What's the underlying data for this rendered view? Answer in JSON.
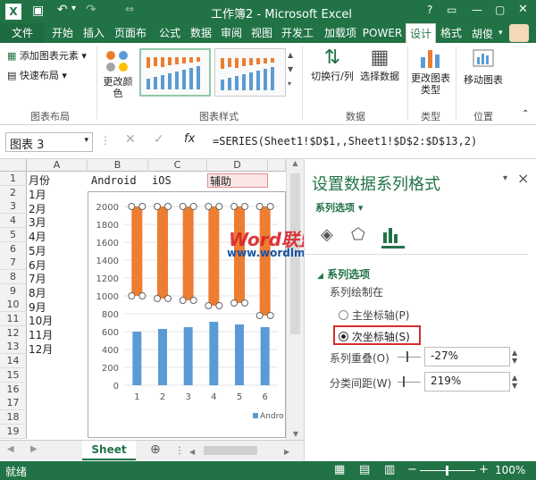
{
  "window": {
    "title": "工作簿2 - Microsoft Excel",
    "help": "?"
  },
  "colors": {
    "excel_green": "#217346",
    "orange": "#ed7d31",
    "blue": "#5b9bd5",
    "highlight_red": "#d32f2f"
  },
  "ribbon_tabs": [
    "文件",
    "开始",
    "插入",
    "页面布",
    "公式",
    "数据",
    "审阅",
    "视图",
    "开发工",
    "加载项",
    "POWER",
    "设计",
    "格式"
  ],
  "user": "胡俊",
  "ribbon": {
    "add_element": "添加图表元素",
    "quick_layout": "快速布局",
    "change_colors": "更改颜色",
    "switch_row_col": "切换行/列",
    "select_data": "选择数据",
    "change_type": "更改图表类型",
    "move_chart": "移动图表",
    "groups": {
      "layout": "图表布局",
      "styles": "图表样式",
      "data": "数据",
      "type": "类型",
      "location": "位置"
    }
  },
  "formula_bar": {
    "name_box": "图表 3",
    "fx": "fx",
    "formula": "=SERIES(Sheet1!$D$1,,Sheet1!$D$2:$D$13,2)"
  },
  "columns": [
    "A",
    "B",
    "C",
    "D"
  ],
  "rows": [
    "1",
    "2",
    "3",
    "4",
    "5",
    "6",
    "7",
    "8",
    "9",
    "10",
    "11",
    "12",
    "13",
    "14",
    "15",
    "16",
    "17",
    "18",
    "19"
  ],
  "cells": {
    "A1": "月份",
    "B1": "Android",
    "C1": "iOS",
    "D1": "辅助",
    "months": [
      "1月",
      "2月",
      "3月",
      "4月",
      "5月",
      "6月",
      "7月",
      "8月",
      "9月",
      "10月",
      "11月",
      "12月"
    ]
  },
  "watermark": {
    "logo": "Word联盟",
    "url": "www.wordlm.com"
  },
  "chart_data": {
    "type": "bar",
    "categories": [
      "1",
      "2",
      "3",
      "4",
      "5",
      "6"
    ],
    "ylim": [
      0,
      2000
    ],
    "yticks": [
      "0",
      "200",
      "400",
      "600",
      "800",
      "1000",
      "1200",
      "1400",
      "1600",
      "1800",
      "2000"
    ],
    "series": [
      {
        "name": "Andro",
        "values": [
          600,
          630,
          650,
          710,
          680,
          650
        ],
        "color": "#5b9bd5"
      },
      {
        "name": "辅助",
        "low": [
          1000,
          970,
          950,
          890,
          920,
          780
        ],
        "high": [
          2000,
          2000,
          2000,
          2000,
          2000,
          2000
        ],
        "color": "#ed7d31"
      }
    ],
    "legend": "Andro"
  },
  "pane": {
    "title": "设置数据系列格式",
    "close": "×",
    "options_dropdown": "系列选项",
    "section": "系列选项",
    "plot_on": "系列绘制在",
    "primary_axis": "主坐标轴(P)",
    "secondary_axis": "次坐标轴(S)",
    "overlap_label": "系列重叠(O)",
    "overlap_value": "-27%",
    "gap_label": "分类间距(W)",
    "gap_value": "219%"
  },
  "sheet_tab": "Sheet",
  "status": {
    "ready": "就绪",
    "zoom": "100%"
  }
}
